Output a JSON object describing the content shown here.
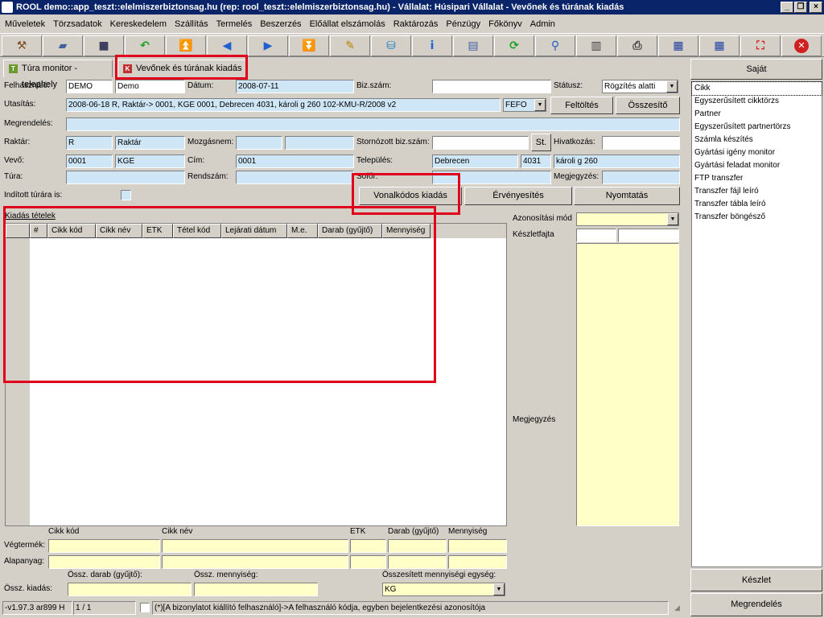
{
  "window": {
    "title": "ROOL demo::app_teszt::elelmiszerbiztonsag.hu (rep: rool_teszt::elelmiszerbiztonsag.hu) - Vállalat: Húsipari Vállalat - Vevőnek és túrának kiadás",
    "controls": [
      "minimize-icon",
      "restore-icon",
      "close-icon"
    ]
  },
  "menu": [
    "Műveletek",
    "Törzsadatok",
    "Kereskedelem",
    "Szállítás",
    "Termelés",
    "Beszerzés",
    "Előállat elszámolás",
    "Raktározás",
    "Pénzügy",
    "Főkönyv",
    "Admin"
  ],
  "toolbar": [
    {
      "name": "hammer-icon",
      "glyph": "⚒",
      "color": "#805020"
    },
    {
      "name": "open-folder-icon",
      "glyph": "▰",
      "color": "#4060a0"
    },
    {
      "name": "save-icon",
      "glyph": "■",
      "color": "#404060"
    },
    {
      "name": "undo-arrow-icon",
      "glyph": "↶",
      "color": "#20a020"
    },
    {
      "name": "first-icon",
      "glyph": "⏫",
      "color": "#2060d0"
    },
    {
      "name": "prev-icon",
      "glyph": "◀",
      "color": "#2060d0"
    },
    {
      "name": "next-icon",
      "glyph": "▶",
      "color": "#2060d0"
    },
    {
      "name": "last-icon",
      "glyph": "⏬",
      "color": "#2060d0"
    },
    {
      "name": "edit-pencil-icon",
      "glyph": "✎",
      "color": "#c08000"
    },
    {
      "name": "database-icon",
      "glyph": "⛁",
      "color": "#2080c0"
    },
    {
      "name": "info-icon",
      "glyph": "i",
      "color": "#2060d0"
    },
    {
      "name": "form-view-icon",
      "glyph": "▤",
      "color": "#4060a0"
    },
    {
      "name": "refresh-icon",
      "glyph": "⟳",
      "color": "#20a020"
    },
    {
      "name": "search-icon",
      "glyph": "⚲",
      "color": "#2060c0"
    },
    {
      "name": "page-icon",
      "glyph": "▥",
      "color": "#404040"
    },
    {
      "name": "print-icon",
      "glyph": "⎙",
      "color": "#404040"
    },
    {
      "name": "grid-export-icon",
      "glyph": "▦",
      "color": "#2040a0"
    },
    {
      "name": "grid-import-icon",
      "glyph": "▦",
      "color": "#2040a0"
    },
    {
      "name": "fullscreen-icon",
      "glyph": "⛶",
      "color": "#d02020"
    },
    {
      "name": "exit-icon",
      "glyph": "✕",
      "color": "#ffffff"
    }
  ],
  "tabs": [
    {
      "label": "Túra monitor - telephely",
      "icon": "tab-tura-icon"
    },
    {
      "label": "Vevőnek és túrának kiadás",
      "icon": "tab-kiadas-icon"
    }
  ],
  "form": {
    "felhasznalo_label": "Felhasználó:",
    "felhasznalo_code": "DEMO",
    "felhasznalo_name": "Demo",
    "datum_label": "Dátum:",
    "datum_value": "2008-07-11",
    "bizszam_label": "Biz.szám:",
    "bizszam_value": "",
    "statusz_label": "Státusz:",
    "statusz_value": "Rögzítés alatti",
    "utasitas_label": "Utasítás:",
    "utasitas_value": "2008-06-18 R, Raktár-> 0001, KGE 0001, Debrecen 4031, károli g 260 102-KMU-R/2008 v2",
    "fefo_value": "FEFO",
    "feltoltes_label": "Feltöltés",
    "osszesito_label": "Összesítő",
    "megrendeles_label": "Megrendelés:",
    "megrendeles_value": "",
    "raktar_label": "Raktár:",
    "raktar_code": "R",
    "raktar_name": "Raktár",
    "mozgasnem_label": "Mozgásnem:",
    "mozgasnem_code": "",
    "mozgasnem_name": "",
    "stornozott_label": "Stornózott biz.szám:",
    "stornozott_value": "",
    "st_button": "St.",
    "hivatkozas_label": "Hivatkozás:",
    "hivatkozas_value": "",
    "vevo_label": "Vevő:",
    "vevo_code": "0001",
    "vevo_name": "KGE",
    "cim_label": "Cím:",
    "cim_value": "0001",
    "telepules_label": "Település:",
    "telepules_name": "Debrecen",
    "telepules_zip": "4031",
    "telepules_street": "károli g 260",
    "tura_label": "Túra:",
    "tura_value": "",
    "rendszam_label": "Rendszám:",
    "rendszam_value": "",
    "sofor_label": "Sofőr:",
    "sofor_value": "",
    "megjegyzes_label": "Megjegyzés:",
    "megjegyzes_value": "",
    "inditott_label": "Indított túrára is:",
    "vonalkodos_label": "Vonalkódos kiadás",
    "ervenyesites_label": "Érvényesítés",
    "nyomtatas_label": "Nyomtatás"
  },
  "items": {
    "section_label": "Kiadás tételek",
    "columns": [
      "#",
      "Cikk kód",
      "Cikk név",
      "ETK",
      "Tétel kód",
      "Lejárati dátum",
      "M.e.",
      "Darab (gyűjtő)",
      "Mennyiség"
    ],
    "rows": []
  },
  "right_form": {
    "azonositasi_label": "Azonosítási mód",
    "azonositasi_value": "",
    "keszletfajta_label": "Készletfajta",
    "megjegyzes_label": "Megjegyzés"
  },
  "bottom": {
    "col_cikk_kod": "Cikk kód",
    "col_cikk_nev": "Cikk név",
    "col_etk": "ETK",
    "col_darab": "Darab (gyűjtő)",
    "col_mennyiseg": "Mennyiség",
    "vegtermek_label": "Végtermék:",
    "alapanyag_label": "Alapanyag:",
    "ossz_darab_label": "Össz. darab (gyűjtő):",
    "ossz_mennyiseg_label": "Össz. mennyiség:",
    "osszesitett_label": "Összesített mennyiségi egység:",
    "ossz_kiadas_label": "Össz. kiadás:",
    "mertekegyseg_value": "KG"
  },
  "status": {
    "version": "-v1.97.3 ar899 H",
    "page": "1 / 1",
    "hint": "(*)[A bizonylatot kiállító felhasználó]->A felhasználó kódja, egyben bejelentkezési azonosítója"
  },
  "sidebar": {
    "header": "Saját",
    "items": [
      "Cikk",
      "Egyszerűsített cikktörzs",
      "Partner",
      "Egyszerűsített partnertörzs",
      "Számla készítés",
      "Gyártási igény monitor",
      "Gyártási feladat monitor",
      "FTP transzfer",
      "Transzfer fájl leíró",
      "Transzfer tábla leíró",
      "Transzfer böngésző"
    ],
    "keszlet_label": "Készlet",
    "megrendeles_label": "Megrendelés"
  },
  "colors": {
    "titlebar": "#0a246a",
    "highlight_box": "#e0001b",
    "field_blue": "#cfe6f7",
    "field_yellow": "#ffffc8"
  }
}
